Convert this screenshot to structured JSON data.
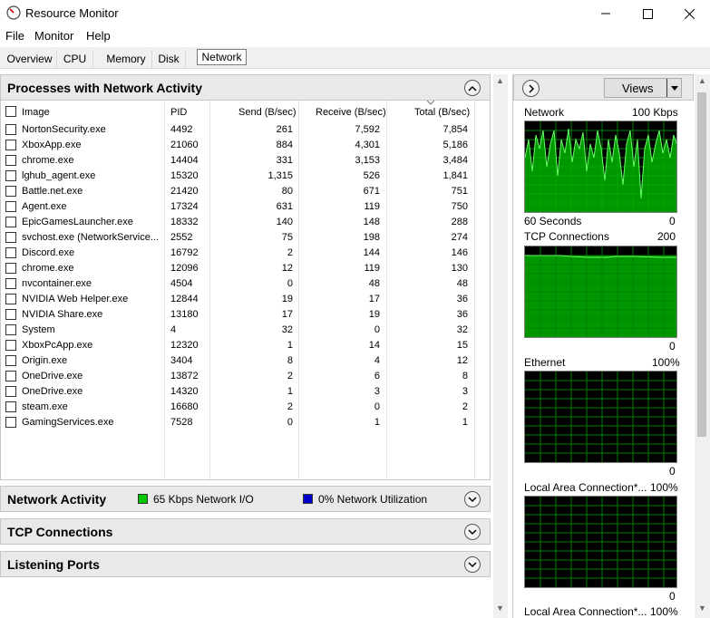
{
  "window": {
    "title": "Resource Monitor"
  },
  "menu": [
    "File",
    "Monitor",
    "Help"
  ],
  "tabs": [
    "Overview",
    "CPU",
    "Memory",
    "Disk",
    "Network"
  ],
  "processes_section": {
    "title": "Processes with Network Activity",
    "columns": [
      "Image",
      "PID",
      "Send (B/sec)",
      "Receive (B/sec)",
      "Total (B/sec)"
    ],
    "rows": [
      {
        "image": "NortonSecurity.exe",
        "pid": "4492",
        "send": "261",
        "receive": "7,592",
        "total": "7,854"
      },
      {
        "image": "XboxApp.exe",
        "pid": "21060",
        "send": "884",
        "receive": "4,301",
        "total": "5,186"
      },
      {
        "image": "chrome.exe",
        "pid": "14404",
        "send": "331",
        "receive": "3,153",
        "total": "3,484"
      },
      {
        "image": "lghub_agent.exe",
        "pid": "15320",
        "send": "1,315",
        "receive": "526",
        "total": "1,841"
      },
      {
        "image": "Battle.net.exe",
        "pid": "21420",
        "send": "80",
        "receive": "671",
        "total": "751"
      },
      {
        "image": "Agent.exe",
        "pid": "17324",
        "send": "631",
        "receive": "119",
        "total": "750"
      },
      {
        "image": "EpicGamesLauncher.exe",
        "pid": "18332",
        "send": "140",
        "receive": "148",
        "total": "288"
      },
      {
        "image": "svchost.exe (NetworkService...",
        "pid": "2552",
        "send": "75",
        "receive": "198",
        "total": "274"
      },
      {
        "image": "Discord.exe",
        "pid": "16792",
        "send": "2",
        "receive": "144",
        "total": "146"
      },
      {
        "image": "chrome.exe",
        "pid": "12096",
        "send": "12",
        "receive": "119",
        "total": "130"
      },
      {
        "image": "nvcontainer.exe",
        "pid": "4504",
        "send": "0",
        "receive": "48",
        "total": "48"
      },
      {
        "image": "NVIDIA Web Helper.exe",
        "pid": "12844",
        "send": "19",
        "receive": "17",
        "total": "36"
      },
      {
        "image": "NVIDIA Share.exe",
        "pid": "13180",
        "send": "17",
        "receive": "19",
        "total": "36"
      },
      {
        "image": "System",
        "pid": "4",
        "send": "32",
        "receive": "0",
        "total": "32"
      },
      {
        "image": "XboxPcApp.exe",
        "pid": "12320",
        "send": "1",
        "receive": "14",
        "total": "15"
      },
      {
        "image": "Origin.exe",
        "pid": "3404",
        "send": "8",
        "receive": "4",
        "total": "12"
      },
      {
        "image": "OneDrive.exe",
        "pid": "13872",
        "send": "2",
        "receive": "6",
        "total": "8"
      },
      {
        "image": "OneDrive.exe",
        "pid": "14320",
        "send": "1",
        "receive": "3",
        "total": "3"
      },
      {
        "image": "steam.exe",
        "pid": "16680",
        "send": "2",
        "receive": "0",
        "total": "2"
      },
      {
        "image": "GamingServices.exe",
        "pid": "7528",
        "send": "0",
        "receive": "1",
        "total": "1"
      }
    ]
  },
  "network_activity": {
    "title": "Network Activity",
    "io_label": "65 Kbps Network I/O",
    "io_color": "#00c800",
    "util_label": "0% Network Utilization",
    "util_color": "#0000c8"
  },
  "tcp_section": {
    "title": "TCP Connections"
  },
  "ports_section": {
    "title": "Listening Ports"
  },
  "right_panel": {
    "views_label": "Views",
    "graphs": [
      {
        "name": "Network",
        "max": "100 Kbps",
        "footer_left": "60 Seconds",
        "footer_right": "0"
      },
      {
        "name": "TCP Connections",
        "max": "200",
        "footer_left": "",
        "footer_right": "0"
      },
      {
        "name": "Ethernet",
        "max": "100%",
        "footer_left": "",
        "footer_right": "0"
      },
      {
        "name": "Local Area Connection*...",
        "max": "100%",
        "footer_left": "",
        "footer_right": "0"
      },
      {
        "name": "Local Area Connection*...",
        "max": "100%",
        "footer_left": "",
        "footer_right": ""
      }
    ]
  }
}
